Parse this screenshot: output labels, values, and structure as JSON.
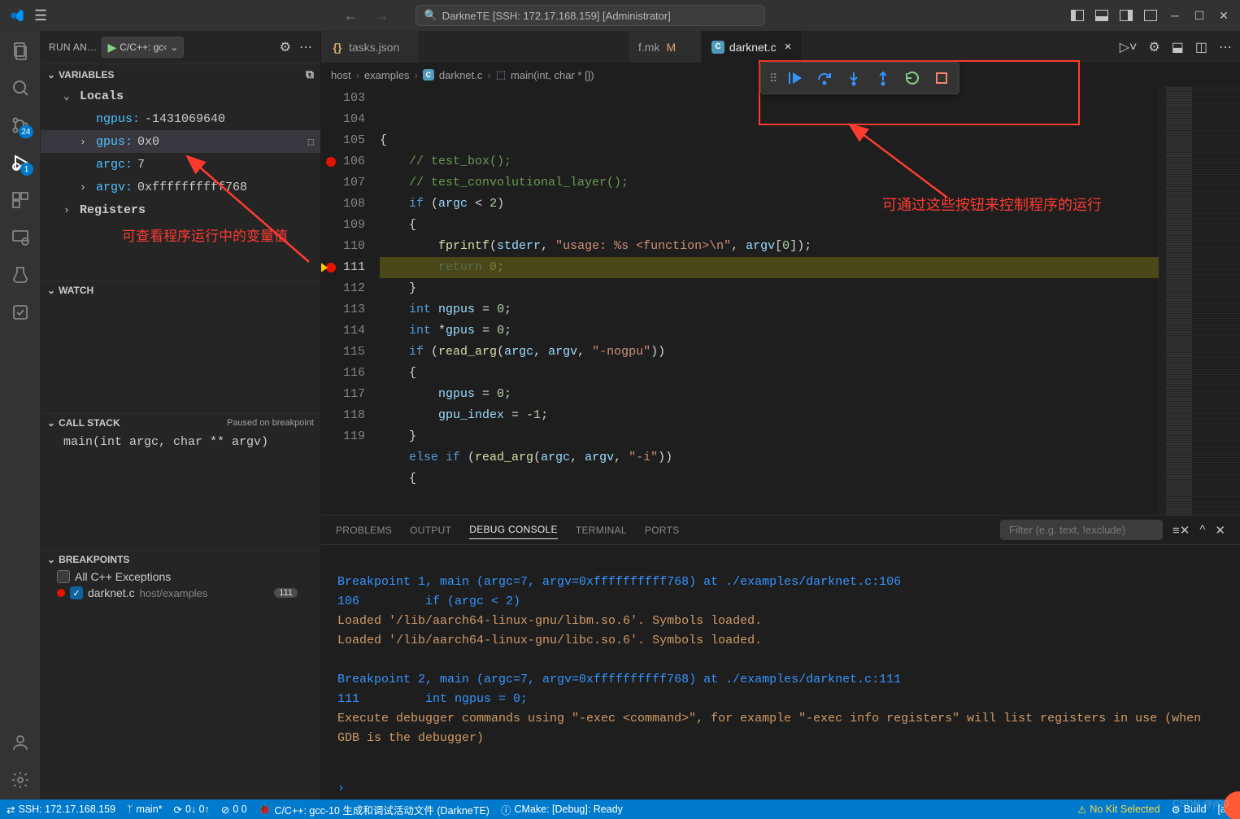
{
  "title": "DarkneTE [SSH: 172.17.168.159] [Administrator]",
  "activitybar": {
    "badge_scm": "24",
    "badge_debug": "1"
  },
  "sidebar": {
    "heading": "RUN AN…",
    "config": "C/C++: gc‹",
    "variables": "VARIABLES",
    "locals": "Locals",
    "vars": {
      "ngpus_name": "ngpus:",
      "ngpus_val": " -1431069640",
      "gpus_name": "gpus:",
      "gpus_val": " 0x0",
      "argc_name": "argc:",
      "argc_val": " 7",
      "argv_name": "argv:",
      "argv_val": " 0xffffffffff768"
    },
    "registers": "Registers",
    "annot": "可查看程序运行中的变量值",
    "watch": "WATCH",
    "callstack": "CALL STACK",
    "callstack_state": "Paused on breakpoint",
    "callstack_frame": "main(int argc, char ** argv)",
    "breakpoints": "BREAKPOINTS",
    "bp_all": "All C++ Exceptions",
    "bp_file": "darknet.c",
    "bp_path": "host/examples",
    "bp_badge": "111"
  },
  "tabs": {
    "t1": "tasks.json",
    "t2": "f.mk",
    "t2_mod": "M",
    "t3": "darknet.c"
  },
  "breadcrumb": {
    "p1": "host",
    "p2": "examples",
    "p3": "darknet.c",
    "p4": "main(int, char * [])"
  },
  "toolbar_annot": "可通过这些按钮来控制程序的运行",
  "code_lines": [
    "103",
    "104",
    "105",
    "106",
    "107",
    "108",
    "109",
    "110",
    "111",
    "112",
    "113",
    "114",
    "115",
    "116",
    "117",
    "118",
    "119"
  ],
  "code": {
    "l103": "{",
    "l104": "    // test_box();",
    "l105": "    // test_convolutional_layer();",
    "l106": "    if (argc < 2)",
    "l107": "    {",
    "l108": "        fprintf(stderr, \"usage: %s <function>\\n\", argv[0]);",
    "l109": "        return 0;",
    "l110": "    }",
    "l111": "    int ngpus = 0;",
    "l112": "    int *gpus = 0;",
    "l113": "    if (read_arg(argc, argv, \"-nogpu\"))",
    "l114": "    {",
    "l115": "        ngpus = 0;",
    "l116": "        gpu_index = -1;",
    "l117": "    }",
    "l118": "    else if (read_arg(argc, argv, \"-i\"))",
    "l119": "    {"
  },
  "panel": {
    "tabs": {
      "problems": "PROBLEMS",
      "output": "OUTPUT",
      "debug": "DEBUG CONSOLE",
      "terminal": "TERMINAL",
      "ports": "PORTS"
    },
    "filter_ph": "Filter (e.g. text, !exclude)",
    "out1": "Breakpoint 1, main (argc=7, argv=0xffffffffff768) at ./examples/darknet.c:106",
    "out2": "106         if (argc < 2)",
    "out3": "Loaded '/lib/aarch64-linux-gnu/libm.so.6'. Symbols loaded.",
    "out4": "Loaded '/lib/aarch64-linux-gnu/libc.so.6'. Symbols loaded.",
    "out5": "Breakpoint 2, main (argc=7, argv=0xffffffffff768) at ./examples/darknet.c:111",
    "out6": "111         int ngpus = 0;",
    "out7": "Execute debugger commands using \"-exec <command>\", for example \"-exec info registers\" will list registers in use (when GDB is the debugger)"
  },
  "status": {
    "ssh": "SSH: 172.17.168.159",
    "branch": "main*",
    "sync": "0↓ 0↑",
    "errwarn": "0  0",
    "task": "C/C++: gcc-10 生成和调试活动文件 (DarkneTE)",
    "cmake": "CMake: [Debug]: Ready",
    "nokit": "No Kit Selected",
    "build": "Build",
    "all": "[all]"
  },
  "watermark": "CSDN @jt00"
}
